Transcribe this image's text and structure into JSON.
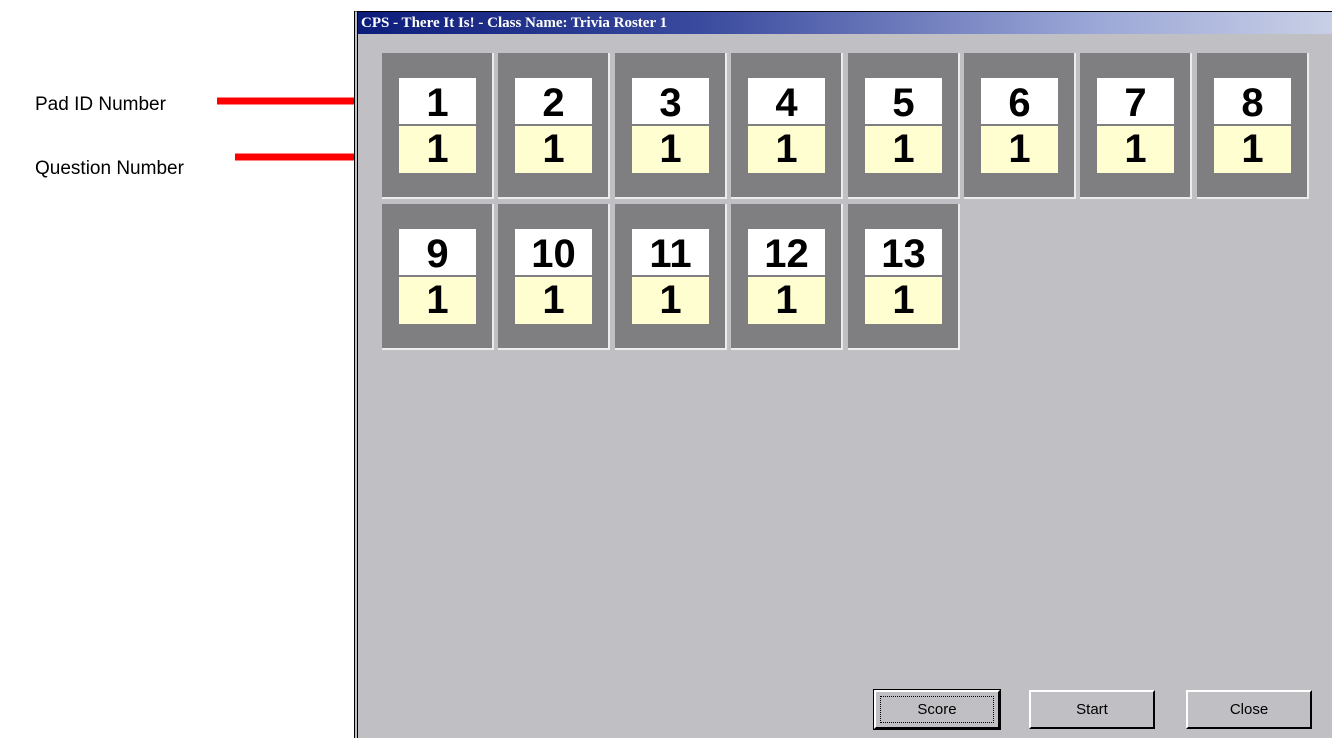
{
  "callouts": {
    "pad_id_label": "Pad ID Number",
    "question_label": "Question Number",
    "arrow_color": "#ff0000"
  },
  "window": {
    "title": "CPS - There It Is! - Class Name: Trivia Roster 1"
  },
  "tiles": [
    {
      "pad": "1",
      "question": "1"
    },
    {
      "pad": "2",
      "question": "1"
    },
    {
      "pad": "3",
      "question": "1"
    },
    {
      "pad": "4",
      "question": "1"
    },
    {
      "pad": "5",
      "question": "1"
    },
    {
      "pad": "6",
      "question": "1"
    },
    {
      "pad": "7",
      "question": "1"
    },
    {
      "pad": "8",
      "question": "1"
    },
    {
      "pad": "9",
      "question": "1"
    },
    {
      "pad": "10",
      "question": "1"
    },
    {
      "pad": "11",
      "question": "1"
    },
    {
      "pad": "12",
      "question": "1"
    },
    {
      "pad": "13",
      "question": "1"
    }
  ],
  "buttons": {
    "score": "Score",
    "start": "Start",
    "close": "Close"
  },
  "colors": {
    "tile_background": "#7f7f81",
    "pad_background": "#ffffff",
    "question_background": "#fefed0",
    "window_background": "#c0bfc4",
    "titlebar_start": "#0c1c7a"
  }
}
